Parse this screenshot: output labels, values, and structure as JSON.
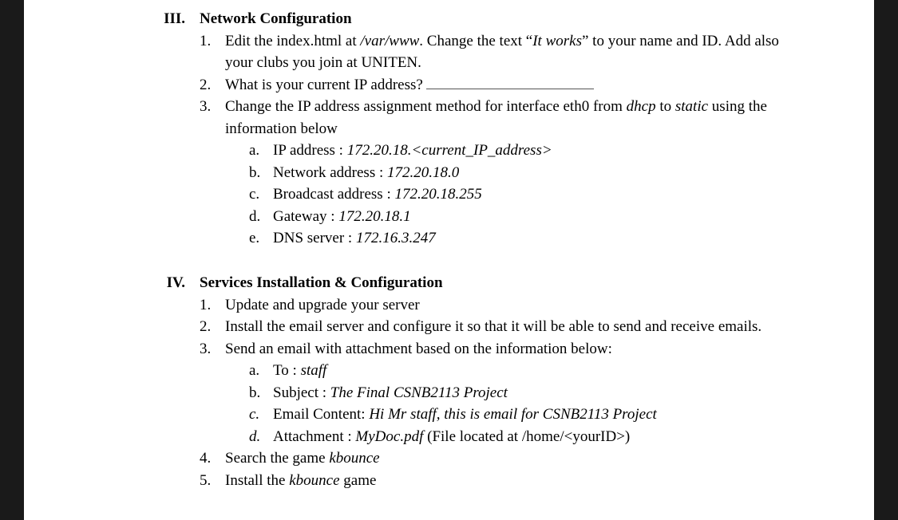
{
  "sections": [
    {
      "roman": "III.",
      "heading": "Network Configuration",
      "items": [
        {
          "num": "1.",
          "parts": [
            {
              "t": "Edit the index.html at "
            },
            {
              "t": "/var/www",
              "i": true
            },
            {
              "t": ". Change the text “"
            },
            {
              "t": "It works",
              "i": true
            },
            {
              "t": "” to your name and ID. Add also your clubs you join at UNITEN."
            }
          ]
        },
        {
          "num": "2.",
          "parts": [
            {
              "t": "What is your current IP address?"
            },
            {
              "blank": true
            }
          ]
        },
        {
          "num": "3.",
          "parts": [
            {
              "t": "Change the IP address assignment method for interface eth0 from "
            },
            {
              "t": "dhcp",
              "i": true
            },
            {
              "t": " to "
            },
            {
              "t": "static",
              "i": true
            },
            {
              "t": " using the information below"
            }
          ],
          "sub": [
            {
              "letter": "a.",
              "parts": [
                {
                  "t": "IP address : "
                },
                {
                  "t": "172.20.18.<current_IP_address>",
                  "i": true
                }
              ]
            },
            {
              "letter": "b.",
              "parts": [
                {
                  "t": "Network address : "
                },
                {
                  "t": "172.20.18.0",
                  "i": true
                }
              ]
            },
            {
              "letter": "c.",
              "parts": [
                {
                  "t": "Broadcast address : "
                },
                {
                  "t": "172.20.18.255",
                  "i": true
                }
              ]
            },
            {
              "letter": "d.",
              "parts": [
                {
                  "t": "Gateway : "
                },
                {
                  "t": "172.20.18.1",
                  "i": true
                }
              ]
            },
            {
              "letter": "e.",
              "parts": [
                {
                  "t": "DNS server : "
                },
                {
                  "t": "172.16.3.247",
                  "i": true
                }
              ]
            }
          ]
        }
      ]
    },
    {
      "roman": "IV.",
      "heading": "Services Installation & Configuration",
      "items": [
        {
          "num": "1.",
          "parts": [
            {
              "t": "Update and upgrade your server"
            }
          ]
        },
        {
          "num": "2.",
          "parts": [
            {
              "t": "Install the email server and configure it so that it will be able to send and receive emails."
            }
          ]
        },
        {
          "num": "3.",
          "parts": [
            {
              "t": "Send an email with attachment based on the information below:"
            }
          ],
          "sub": [
            {
              "letter": "a.",
              "parts": [
                {
                  "t": "To : "
                },
                {
                  "t": "staff",
                  "i": true
                }
              ]
            },
            {
              "letter": "b.",
              "parts": [
                {
                  "t": "Subject : "
                },
                {
                  "t": "The Final CSNB2113 Project",
                  "i": true
                }
              ]
            },
            {
              "letter": "c.",
              "letterItalic": true,
              "parts": [
                {
                  "t": "Email Content: "
                },
                {
                  "t": "Hi Mr staff, this is email for CSNB2113 Project",
                  "i": true
                }
              ]
            },
            {
              "letter": "d.",
              "letterItalic": true,
              "parts": [
                {
                  "t": "Attachment : "
                },
                {
                  "t": "MyDoc.pdf",
                  "i": true
                },
                {
                  "t": " (File located at /home/<yourID>)"
                }
              ]
            }
          ]
        },
        {
          "num": "4.",
          "parts": [
            {
              "t": "Search the game "
            },
            {
              "t": "kbounce",
              "i": true
            }
          ]
        },
        {
          "num": "5.",
          "parts": [
            {
              "t": "Install the "
            },
            {
              "t": "kbounce",
              "i": true
            },
            {
              "t": " game"
            }
          ]
        }
      ]
    }
  ]
}
